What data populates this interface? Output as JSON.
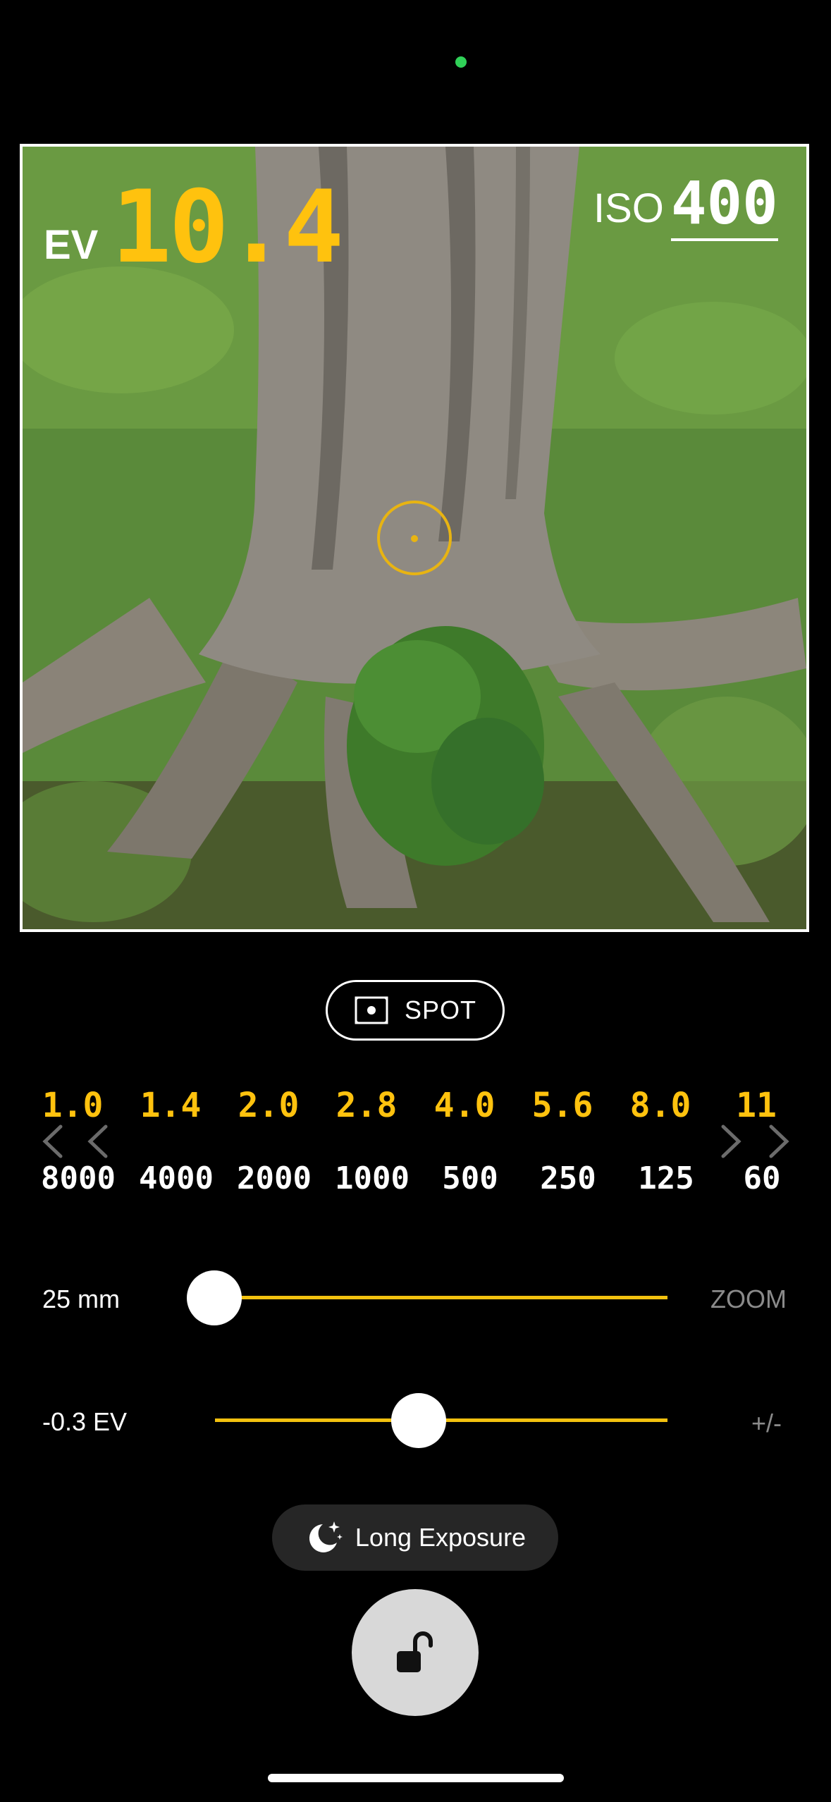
{
  "status": {
    "indicator_color": "#30D158"
  },
  "viewfinder": {
    "ev_label": "EV",
    "ev_value": "10.4",
    "iso_label": "ISO",
    "iso_value": "400"
  },
  "metering": {
    "mode_label": "SPOT",
    "icon": "spot-metering-icon"
  },
  "apertures": [
    "1.0",
    "1.4",
    "2.0",
    "2.8",
    "4.0",
    "5.6",
    "8.0",
    "11"
  ],
  "shutter_speeds": [
    "8000",
    "4000",
    "2000",
    "1000",
    "500",
    "250",
    "125",
    "60"
  ],
  "zoom": {
    "value_label": "25 mm",
    "right_label": "ZOOM",
    "level": 0.0
  },
  "exposure_comp": {
    "value_label": "-0.3 EV",
    "right_label": "+/-",
    "level": 0.45
  },
  "long_exposure": {
    "label": "Long Exposure",
    "icon": "moon-stars-icon"
  },
  "lock": {
    "icon": "unlocked-padlock-icon"
  },
  "colors": {
    "accent": "#FFC20E",
    "track": "#F2C10F"
  }
}
